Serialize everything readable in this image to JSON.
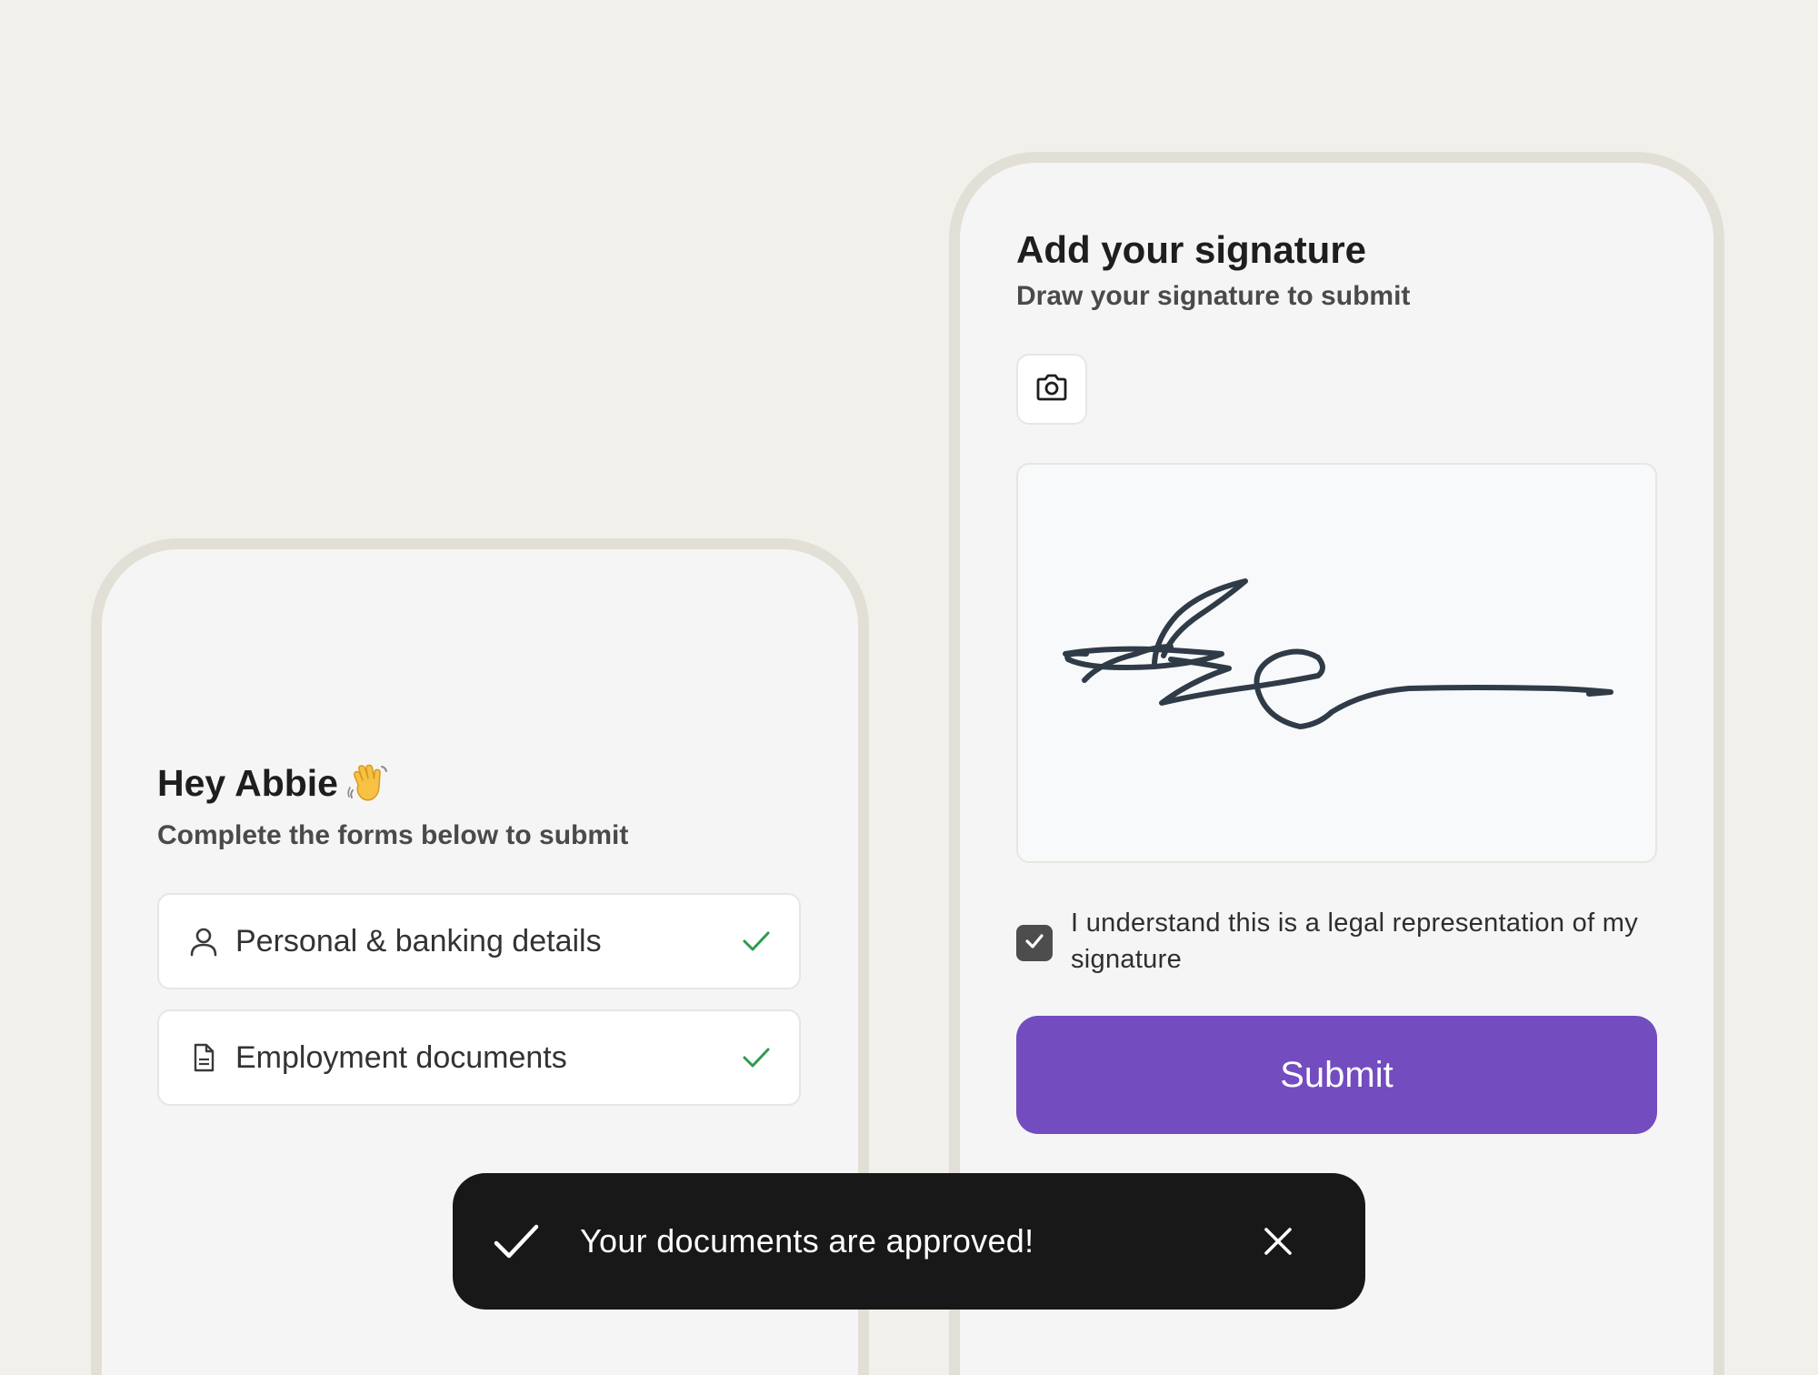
{
  "onboarding": {
    "greeting": "Hey Abbie",
    "greeting_emoji_icon": "waving-hand-icon",
    "subtitle": "Complete the forms below to submit",
    "forms": [
      {
        "label": "Personal & banking details",
        "icon": "user-icon",
        "status": "complete"
      },
      {
        "label": "Employment documents",
        "icon": "document-icon",
        "status": "complete"
      }
    ],
    "check_color": "#2E9B4E"
  },
  "signature": {
    "title": "Add your signature",
    "subtitle": "Draw your signature to submit",
    "camera_icon": "camera-icon",
    "consent_checked": true,
    "consent_text": "I understand this is a legal representation of my signature",
    "submit_label": "Submit",
    "accent_color": "#734CBF"
  },
  "toast": {
    "message": "Your documents are approved!",
    "icon": "checkmark-icon",
    "close_icon": "close-icon"
  }
}
